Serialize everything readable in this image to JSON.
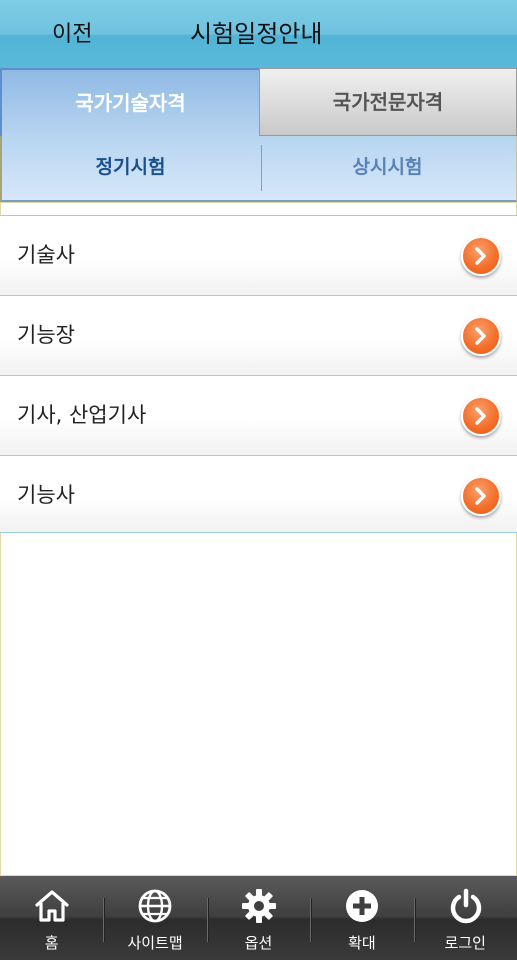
{
  "header": {
    "back_label": "이전",
    "title": "시험일정안내"
  },
  "main_tabs": [
    {
      "label": "국가기술자격",
      "active": true
    },
    {
      "label": "국가전문자격",
      "active": false
    }
  ],
  "sub_tabs": [
    {
      "label": "정기시험",
      "active": true
    },
    {
      "label": "상시시험",
      "active": false
    }
  ],
  "list": {
    "items": [
      {
        "label": "기술사"
      },
      {
        "label": "기능장"
      },
      {
        "label": "기사, 산업기사"
      },
      {
        "label": "기능사"
      }
    ]
  },
  "bottom_nav": {
    "items": [
      {
        "label": "홈",
        "icon": "home-icon"
      },
      {
        "label": "사이트맵",
        "icon": "globe-icon"
      },
      {
        "label": "옵션",
        "icon": "gear-icon"
      },
      {
        "label": "확대",
        "icon": "plus-circle-icon"
      },
      {
        "label": "로그인",
        "icon": "power-icon"
      }
    ]
  },
  "colors": {
    "header": "#5ab9da",
    "active_tab_text": "#ffffff",
    "active_subtab_text": "#1c4f8e",
    "arrow_button": "#f36c28",
    "bottom_nav": "#3a3a3a"
  }
}
